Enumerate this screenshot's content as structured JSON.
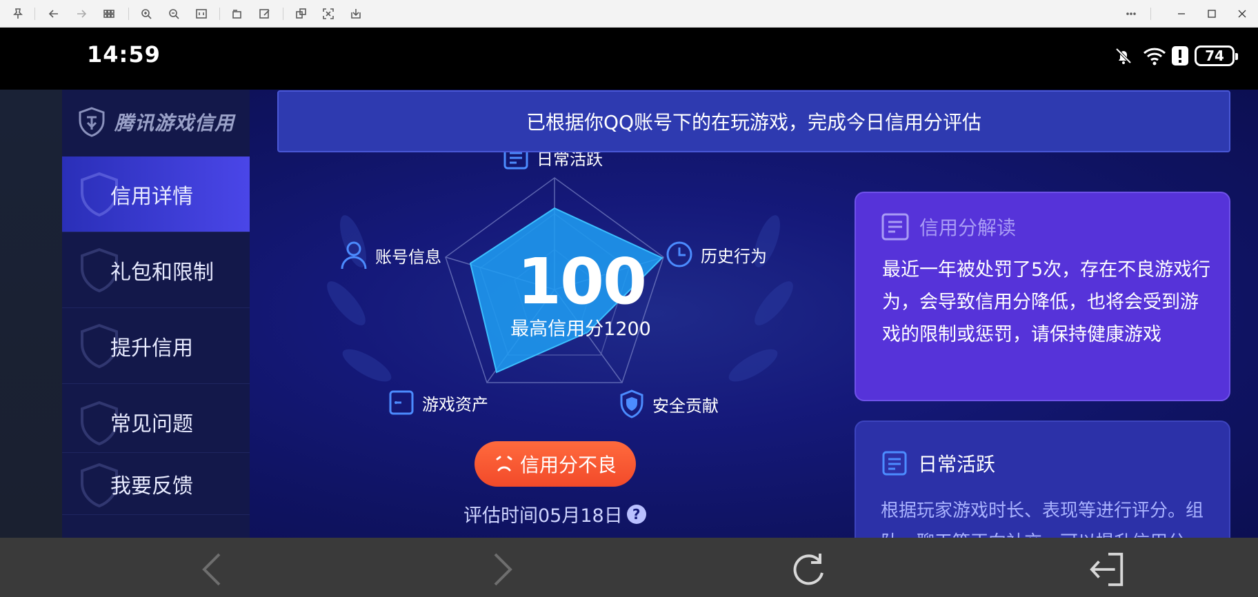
{
  "statusbar": {
    "time": "14:59",
    "battery": "74"
  },
  "sidebar": {
    "logo_text": "腾讯游戏信用",
    "items": [
      {
        "label": "信用详情"
      },
      {
        "label": "礼包和限制"
      },
      {
        "label": "提升信用"
      },
      {
        "label": "常见问题"
      },
      {
        "label": "我要反馈"
      }
    ]
  },
  "banner": {
    "text": "已根据你QQ账号下的在玩游戏，完成今日信用分评估"
  },
  "radar": {
    "labels": {
      "daily": "日常活跃",
      "history": "历史行为",
      "security": "安全贡献",
      "assets": "游戏资产",
      "account": "账号信息"
    },
    "score": "100",
    "max_score": "最高信用分1200"
  },
  "status": {
    "label": "信用分不良"
  },
  "eval_time": "评估时间05月18日",
  "card1": {
    "title": "信用分解读",
    "body": "最近一年被处罚了5次，存在不良游戏行为，会导致信用分降低，也将会受到游戏的限制或惩罚，请保持健康游戏"
  },
  "card2": {
    "title": "日常活跃",
    "body": "根据玩家游戏时长、表现等进行评分。组队、聊天等正向社交，可以提升信用分，恶"
  },
  "colors": {
    "accent": "#4a46e8",
    "alert": "#f24a2a",
    "card": "#5633d9"
  }
}
